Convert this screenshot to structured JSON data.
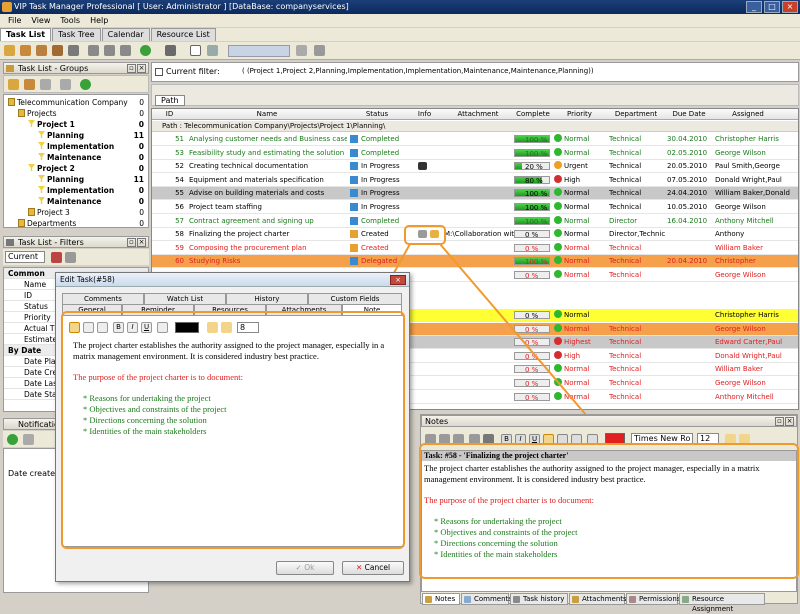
{
  "app": {
    "title": "VIP Task Manager Professional [ User: Administrator ] [DataBase: companyservices]"
  },
  "menu": [
    "File",
    "View",
    "Tools",
    "Help"
  ],
  "main_tabs": [
    "Task List",
    "Task Tree",
    "Calendar",
    "Resource List"
  ],
  "groups_panel": {
    "title": "Task List - Groups",
    "items": [
      {
        "label": "Telecommunication Company",
        "count": "0",
        "indent": 0,
        "bold": false,
        "icon": "folder"
      },
      {
        "label": "Projects",
        "count": "0",
        "indent": 1,
        "bold": false,
        "icon": "folder"
      },
      {
        "label": "Project 1",
        "count": "0",
        "indent": 2,
        "bold": true,
        "icon": "filter"
      },
      {
        "label": "Planning",
        "count": "11",
        "indent": 3,
        "bold": true,
        "icon": "filter"
      },
      {
        "label": "Implementation",
        "count": "0",
        "indent": 3,
        "bold": true,
        "icon": "filter"
      },
      {
        "label": "Maintenance",
        "count": "0",
        "indent": 3,
        "bold": true,
        "icon": "filter"
      },
      {
        "label": "Project 2",
        "count": "0",
        "indent": 2,
        "bold": true,
        "icon": "filter"
      },
      {
        "label": "Planning",
        "count": "11",
        "indent": 3,
        "bold": true,
        "icon": "filter"
      },
      {
        "label": "Implementation",
        "count": "0",
        "indent": 3,
        "bold": true,
        "icon": "filter"
      },
      {
        "label": "Maintenance",
        "count": "0",
        "indent": 3,
        "bold": true,
        "icon": "filter"
      },
      {
        "label": "Project 3",
        "count": "0",
        "indent": 2,
        "bold": false,
        "icon": "folder"
      },
      {
        "label": "Departments",
        "count": "0",
        "indent": 1,
        "bold": false,
        "icon": "folder"
      }
    ]
  },
  "filters_panel": {
    "title": "Task List - Filters",
    "current": "Current",
    "sections": [
      {
        "label": "Common",
        "header": true
      },
      {
        "label": "Name"
      },
      {
        "label": "ID"
      },
      {
        "label": "Status"
      },
      {
        "label": "Priority"
      },
      {
        "label": "Actual Tim"
      },
      {
        "label": "Estimated"
      },
      {
        "label": "By Date",
        "header": true
      },
      {
        "label": "Date Planne"
      },
      {
        "label": "Date Creat"
      },
      {
        "label": "Date Last"
      },
      {
        "label": "Date Start"
      }
    ]
  },
  "notifications": {
    "title": "Notification",
    "date_created_label": "Date created:"
  },
  "filter_bar": {
    "checkbox_label": "Current filter:",
    "filter_text": "( (Project 1,Project 2,Planning,Implementation,Implementation,Maintenance,Maintenance,Planning))"
  },
  "grouping": {
    "path_button": "Path",
    "group_row": "Path : Telecommunication Company\\Projects\\Project 1\\Planning\\"
  },
  "grid": {
    "columns": [
      "ID",
      "Name",
      "Status",
      "Info",
      "Attachment",
      "Complete",
      "Priority",
      "Department",
      "Due Date",
      "Assigned"
    ],
    "rows": [
      {
        "id": "51",
        "name": "Analysing customer needs and Business case",
        "status": "Completed",
        "info": "",
        "attachment": "",
        "complete": "100 %",
        "complete_pct": 100,
        "priority": "Normal",
        "dept": "Technical",
        "due": "30.04.2010",
        "assigned": "Christopher Harris",
        "color": "green",
        "bg": "#ffffff"
      },
      {
        "id": "53",
        "name": "Feasibility study and estimating the solution",
        "status": "Completed",
        "info": "",
        "attachment": "",
        "complete": "100 %",
        "complete_pct": 100,
        "priority": "Normal",
        "dept": "Technical",
        "due": "02.05.2010",
        "assigned": "George Wilson",
        "color": "green",
        "bg": "#ffffff"
      },
      {
        "id": "52",
        "name": "Creating technical documentation",
        "status": "In Progress",
        "info": "clock",
        "attachment": "",
        "complete": "20 %",
        "complete_pct": 20,
        "priority": "Urgent",
        "dept": "Technical",
        "due": "20.05.2010",
        "assigned": "Paul Smith,George",
        "color": "black",
        "bg": "#ffffff"
      },
      {
        "id": "54",
        "name": "Equipment and materials specification",
        "status": "In Progress",
        "info": "",
        "attachment": "",
        "complete": "80 %",
        "complete_pct": 80,
        "priority": "High",
        "dept": "Technical",
        "due": "07.05.2010",
        "assigned": "Donald Wright,Paul",
        "color": "black",
        "bg": "#ffffff"
      },
      {
        "id": "55",
        "name": "Advise on building materials and costs",
        "status": "In Progress",
        "info": "",
        "attachment": "",
        "complete": "100 %",
        "complete_pct": 100,
        "priority": "Normal",
        "dept": "Technical",
        "due": "24.04.2010",
        "assigned": "William Baker,Donald",
        "color": "black",
        "bg": "#c8c8c8"
      },
      {
        "id": "56",
        "name": "Project team staffing",
        "status": "In Progress",
        "info": "",
        "attachment": "",
        "complete": "100 %",
        "complete_pct": 100,
        "priority": "Normal",
        "dept": "Technical",
        "due": "10.05.2010",
        "assigned": "George Wilson",
        "color": "black",
        "bg": "#ffffff"
      },
      {
        "id": "57",
        "name": "Contract agreement and signing up",
        "status": "Completed",
        "info": "",
        "attachment": "",
        "complete": "100 %",
        "complete_pct": 100,
        "priority": "Normal",
        "dept": "Director",
        "due": "16.04.2010",
        "assigned": "Anthony Mitchell",
        "color": "green",
        "bg": "#ffffff"
      },
      {
        "id": "58",
        "name": "Finalizing the project charter",
        "status": "Created",
        "info": "note",
        "attachment": "M:\\Collaboration with",
        "complete": "0 %",
        "complete_pct": 0,
        "priority": "Normal",
        "dept": "Director,Technica",
        "due": "",
        "assigned": "Anthony",
        "color": "black",
        "bg": "#ffffff"
      },
      {
        "id": "59",
        "name": "Composing the procurement plan",
        "status": "Created",
        "info": "",
        "attachment": "",
        "complete": "0 %",
        "complete_pct": 0,
        "priority": "Normal",
        "dept": "Technical",
        "due": "",
        "assigned": "William Baker",
        "color": "red",
        "bg": "#ffffff"
      },
      {
        "id": "60",
        "name": "Studying Risks",
        "status": "Delegated",
        "info": "",
        "attachment": "",
        "complete": "100 %",
        "complete_pct": 100,
        "priority": "Normal",
        "dept": "Technical",
        "due": "20.04.2010",
        "assigned": "Christopher",
        "color": "red",
        "bg": "#f5a04a"
      },
      {
        "id": "",
        "name": "",
        "status": "",
        "info": "",
        "attachment": "",
        "complete": "0 %",
        "complete_pct": 0,
        "priority": "Normal",
        "dept": "Technical",
        "due": "",
        "assigned": "George Wilson",
        "color": "red",
        "bg": "#ffffff"
      }
    ],
    "rows2": [
      {
        "complete": "0 %",
        "priority": "Normal",
        "dept": "",
        "assigned": "Christopher Harris",
        "bg": "#ffff33",
        "color": "black"
      },
      {
        "complete": "0 %",
        "priority": "Normal",
        "dept": "Technical",
        "assigned": "George Wilson",
        "bg": "#f5a04a",
        "color": "red"
      },
      {
        "complete": "0 %",
        "priority": "Highest",
        "dept": "Technical",
        "assigned": "Edward Carter,Paul",
        "bg": "#c8c8c8",
        "color": "red"
      },
      {
        "complete": "0 %",
        "priority": "High",
        "dept": "Technical",
        "assigned": "Donald Wright,Paul",
        "bg": "#ffffff",
        "color": "red"
      },
      {
        "complete": "0 %",
        "priority": "Normal",
        "dept": "Technical",
        "assigned": "William Baker",
        "bg": "#ffffff",
        "color": "red"
      },
      {
        "complete": "0 %",
        "priority": "Normal",
        "dept": "Technical",
        "assigned": "George Wilson",
        "bg": "#ffffff",
        "color": "red"
      },
      {
        "complete": "0 %",
        "priority": "Normal",
        "dept": "Technical",
        "assigned": "Anthony Mitchell",
        "bg": "#ffffff",
        "color": "red"
      }
    ]
  },
  "dialog": {
    "title": "Edit Task(#58)",
    "tabs_top": [
      "Comments",
      "Watch List",
      "History",
      "Custom Fields"
    ],
    "tabs_bottom": [
      "General",
      "Reminder",
      "Resources",
      "Attachments",
      "Note"
    ],
    "font_size": "8",
    "ok": "Ok",
    "cancel": "Cancel"
  },
  "note": {
    "intro": "The project charter establishes the authority assigned to the project manager, especially in a matrix management environment. It is considered industry best practice.",
    "purpose": "The purpose of the project charter is to document:",
    "bullets": [
      "* Reasons for undertaking the project",
      "* Objectives and constraints of the project",
      "* Directions concerning the solution",
      "* Identities of the main stakeholders"
    ]
  },
  "notes_panel": {
    "title": "Notes",
    "font": "Times New Ro",
    "size": "12",
    "task_line": "Task: #58 - 'Finalizing the project charter'"
  },
  "bottom_tabs": [
    "Notes",
    "Comments",
    "Task history",
    "Attachments",
    "Permissions",
    "Resource Assignment"
  ],
  "colors": {
    "accent": "#ef9a2e",
    "green": "#1a7a1a",
    "red": "#e02020"
  }
}
